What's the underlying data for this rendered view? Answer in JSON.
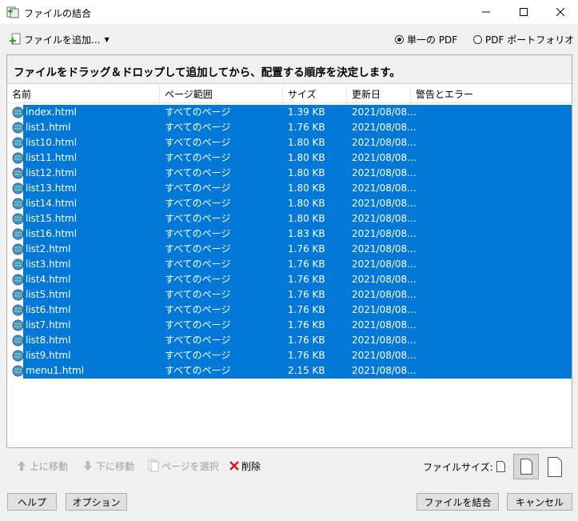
{
  "window": {
    "title": "ファイルの結合"
  },
  "toolbar": {
    "add_files_label": "ファイルを追加...",
    "mode_single": "単一の PDF",
    "mode_portfolio": "PDF ポートフォリオ",
    "selected_mode": "single"
  },
  "instruction": "ファイルをドラッグ＆ドロップして追加してから、配置する順序を決定します。",
  "table": {
    "columns": [
      "名前",
      "ページ範囲",
      "サイズ",
      "更新日",
      "警告とエラー"
    ],
    "rows": [
      {
        "name": "index.html",
        "range": "すべてのページ",
        "size": "1.39 KB",
        "date": "2021/08/08...",
        "warn": ""
      },
      {
        "name": "list1.html",
        "range": "すべてのページ",
        "size": "1.76 KB",
        "date": "2021/08/08...",
        "warn": ""
      },
      {
        "name": "list10.html",
        "range": "すべてのページ",
        "size": "1.80 KB",
        "date": "2021/08/08...",
        "warn": ""
      },
      {
        "name": "list11.html",
        "range": "すべてのページ",
        "size": "1.80 KB",
        "date": "2021/08/08...",
        "warn": ""
      },
      {
        "name": "list12.html",
        "range": "すべてのページ",
        "size": "1.80 KB",
        "date": "2021/08/08...",
        "warn": ""
      },
      {
        "name": "list13.html",
        "range": "すべてのページ",
        "size": "1.80 KB",
        "date": "2021/08/08...",
        "warn": ""
      },
      {
        "name": "list14.html",
        "range": "すべてのページ",
        "size": "1.80 KB",
        "date": "2021/08/08...",
        "warn": ""
      },
      {
        "name": "list15.html",
        "range": "すべてのページ",
        "size": "1.80 KB",
        "date": "2021/08/08...",
        "warn": ""
      },
      {
        "name": "list16.html",
        "range": "すべてのページ",
        "size": "1.83 KB",
        "date": "2021/08/08...",
        "warn": ""
      },
      {
        "name": "list2.html",
        "range": "すべてのページ",
        "size": "1.76 KB",
        "date": "2021/08/08...",
        "warn": ""
      },
      {
        "name": "list3.html",
        "range": "すべてのページ",
        "size": "1.76 KB",
        "date": "2021/08/08...",
        "warn": ""
      },
      {
        "name": "list4.html",
        "range": "すべてのページ",
        "size": "1.76 KB",
        "date": "2021/08/08...",
        "warn": ""
      },
      {
        "name": "list5.html",
        "range": "すべてのページ",
        "size": "1.76 KB",
        "date": "2021/08/08...",
        "warn": ""
      },
      {
        "name": "list6.html",
        "range": "すべてのページ",
        "size": "1.76 KB",
        "date": "2021/08/08...",
        "warn": ""
      },
      {
        "name": "list7.html",
        "range": "すべてのページ",
        "size": "1.76 KB",
        "date": "2021/08/08...",
        "warn": ""
      },
      {
        "name": "list8.html",
        "range": "すべてのページ",
        "size": "1.76 KB",
        "date": "2021/08/08...",
        "warn": ""
      },
      {
        "name": "list9.html",
        "range": "すべてのページ",
        "size": "1.76 KB",
        "date": "2021/08/08...",
        "warn": ""
      },
      {
        "name": "menu1.html",
        "range": "すべてのページ",
        "size": "2.15 KB",
        "date": "2021/08/08...",
        "warn": ""
      }
    ]
  },
  "bottom_toolbar": {
    "move_up": "上に移動",
    "move_down": "下に移動",
    "select_pages": "ページを選択",
    "delete": "削除",
    "file_size_label": "ファイルサイズ:"
  },
  "footer": {
    "help": "ヘルプ",
    "options": "オプション",
    "combine": "ファイルを結合",
    "cancel": "キャンセル"
  },
  "colors": {
    "selection": "#0078d7",
    "delete_icon": "#d11f1f",
    "add_icon": "#3aa537"
  },
  "icons": {
    "app": "combine-files-icon",
    "file": "html-file-icon",
    "size_small": "page-small-icon",
    "size_medium": "page-medium-icon",
    "size_large": "page-large-icon"
  }
}
